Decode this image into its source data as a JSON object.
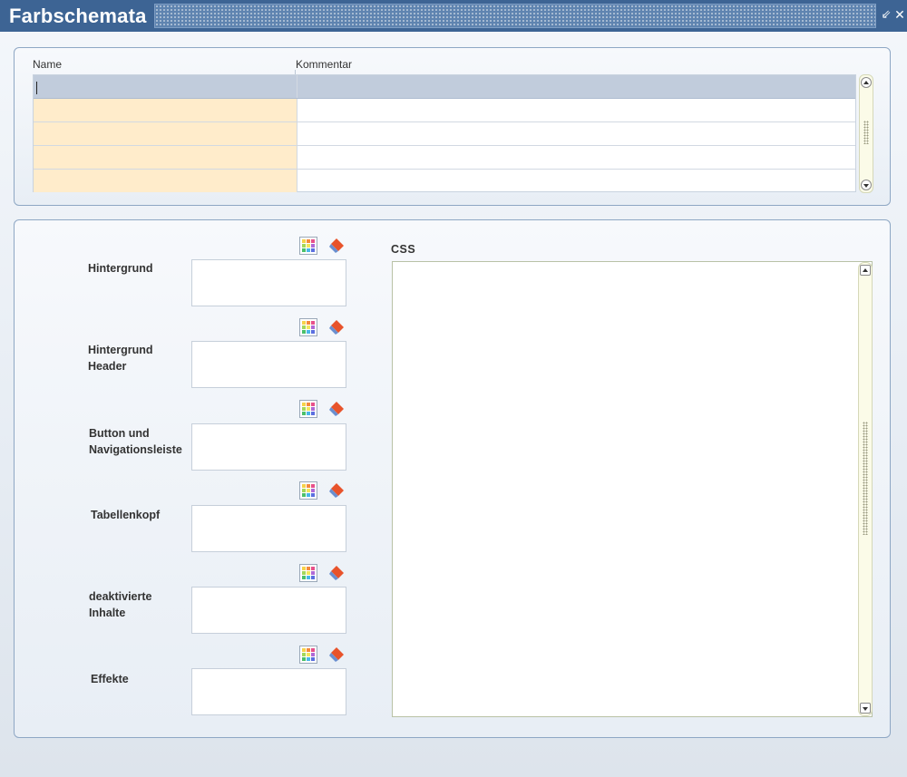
{
  "window": {
    "title": "Farbschemata",
    "minimize_glyph": "⇙",
    "close_glyph": "✕"
  },
  "table": {
    "columns": [
      {
        "key": "name",
        "label": "Name"
      },
      {
        "key": "comment",
        "label": "Kommentar"
      }
    ],
    "rows": [
      {
        "name": "",
        "comment": "",
        "selected": true
      },
      {
        "name": "",
        "comment": "",
        "selected": false
      },
      {
        "name": "",
        "comment": "",
        "selected": false
      },
      {
        "name": "",
        "comment": "",
        "selected": false
      },
      {
        "name": "",
        "comment": "",
        "selected": false
      }
    ]
  },
  "fields": [
    {
      "id": "hintergrund",
      "label": "Hintergrund",
      "value": ""
    },
    {
      "id": "hintergrund-header",
      "label": "Hintergrund Header",
      "value": ""
    },
    {
      "id": "button-navigation",
      "label": "Button und Navigationsleiste",
      "value": ""
    },
    {
      "id": "tabellenkopf",
      "label": "Tabellenkopf",
      "value": ""
    },
    {
      "id": "deaktivierte-inhalte",
      "label": "deaktivierte Inhalte",
      "value": ""
    },
    {
      "id": "effekte",
      "label": "Effekte",
      "value": ""
    }
  ],
  "css": {
    "label": "CSS",
    "value": ""
  },
  "icons": {
    "palette": "palette-icon",
    "eraser": "eraser-icon",
    "scroll_up": "chevron-up-icon",
    "scroll_down": "chevron-down-icon"
  },
  "colors": {
    "titlebar": "#3d6494",
    "selected_row": "#c1ccdc",
    "name_cell": "#ffeccb",
    "scrollbar_track": "#fbfbe8"
  }
}
